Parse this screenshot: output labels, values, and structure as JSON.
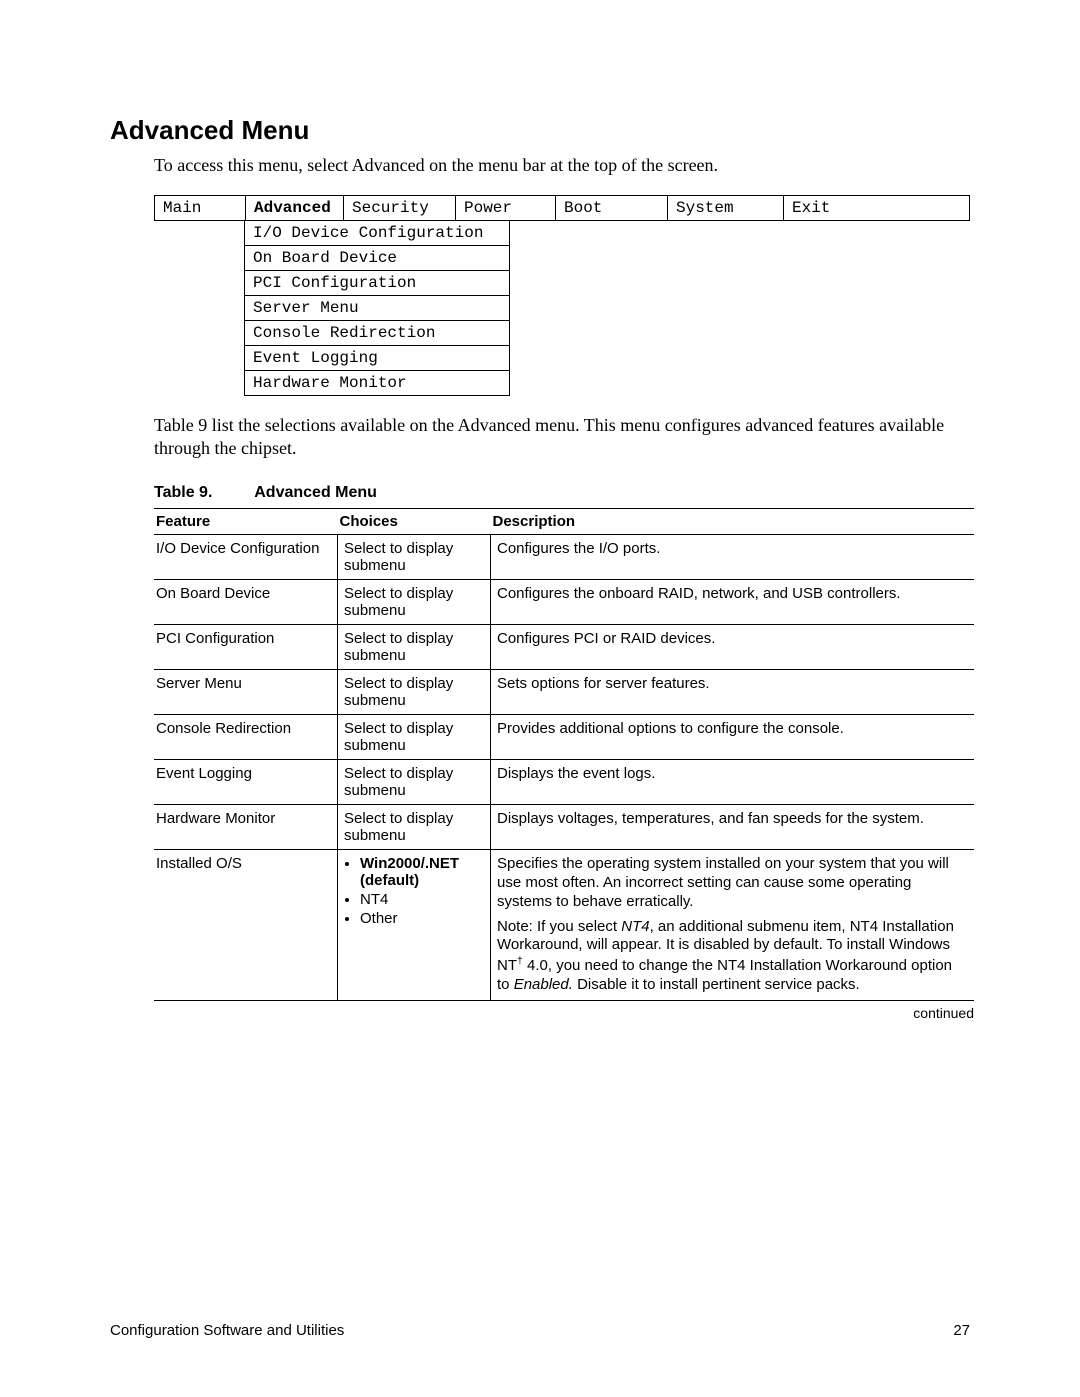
{
  "heading": "Advanced Menu",
  "intro": "To access this menu, select Advanced on the menu bar at the top of the screen.",
  "menu_bar": {
    "items": [
      "Main",
      "Advanced",
      "Security",
      "Power",
      "Boot",
      "System",
      "Exit"
    ],
    "active_index": 1
  },
  "submenu": [
    "I/O Device Configuration",
    "On Board Device",
    "PCI Configuration",
    "Server Menu",
    "Console Redirection",
    "Event Logging",
    "Hardware Monitor"
  ],
  "paragraph": "Table 9 list the selections available on the Advanced menu.  This menu configures advanced features available through the chipset.",
  "table": {
    "caption_num": "Table 9.",
    "caption_title": "Advanced Menu",
    "headers": {
      "feature": "Feature",
      "choices": "Choices",
      "description": "Description"
    },
    "rows": [
      {
        "feature": "I/O Device Configuration",
        "choices_text": "Select to display submenu",
        "description_plain": "Configures the I/O ports."
      },
      {
        "feature": "On Board Device",
        "choices_text": "Select to display submenu",
        "description_plain": "Configures the onboard RAID, network, and USB controllers."
      },
      {
        "feature": "PCI Configuration",
        "choices_text": "Select to display submenu",
        "description_plain": "Configures PCI or RAID devices."
      },
      {
        "feature": "Server Menu",
        "choices_text": "Select to display submenu",
        "description_plain": "Sets options for server features."
      },
      {
        "feature": "Console Redirection",
        "choices_text": "Select to display submenu",
        "description_plain": "Provides additional options to configure the console."
      },
      {
        "feature": "Event Logging",
        "choices_text": "Select to display submenu",
        "description_plain": "Displays the event logs."
      },
      {
        "feature": "Hardware Monitor",
        "choices_text": "Select to display submenu",
        "description_plain": "Displays voltages, temperatures, and fan speeds for the system."
      },
      {
        "feature": "Installed O/S",
        "choices_list": [
          {
            "text": "Win2000/.NET (default)",
            "bold": true
          },
          {
            "text": "NT4",
            "bold": false
          },
          {
            "text": "Other",
            "bold": false
          }
        ],
        "description_os": {
          "p1": "Specifies the operating system installed on your system that you will use most often.  An incorrect setting can cause some operating systems to behave erratically.",
          "note_prefix": "Note:  If you select ",
          "note_italic1": "NT4",
          "note_mid1": ", an additional submenu item, NT4 Installation Workaround, will appear.  It is disabled by default.  To install Windows NT",
          "note_dagger": "†",
          "note_mid2": " 4.0, you need to change the NT4 Installation Workaround option to ",
          "note_italic2": "Enabled.",
          "note_tail": "  Disable it to install pertinent service packs."
        }
      }
    ],
    "continued": "continued"
  },
  "footer": {
    "left": "Configuration Software and Utilities",
    "right": "27"
  }
}
